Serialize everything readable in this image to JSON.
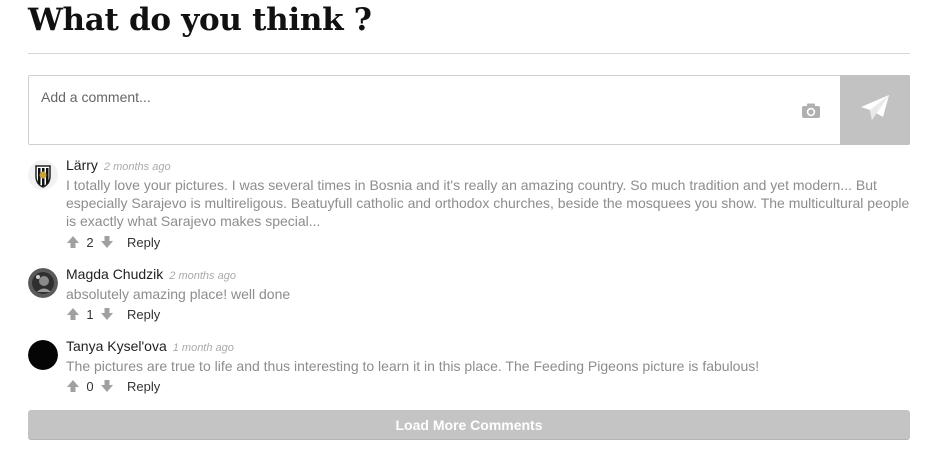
{
  "section": {
    "title": "What do you think ?"
  },
  "composer": {
    "placeholder": "Add a comment...",
    "camera_icon": "camera-icon",
    "send_icon": "paper-plane-icon",
    "send_color": "#c2c2c2"
  },
  "comments": [
    {
      "author": "Lärry",
      "time": "2 months ago",
      "text": "I totally love your pictures. I was several times in Bosnia and it's really an amazing country. So much tradition and yet modern... But especially Sarajevo is multireligous. Beatuyfull catholic and orthodox churches, beside the mosquees you show. The multicultural people is exactly what Sarajevo makes special...",
      "votes": "2",
      "reply": "Reply"
    },
    {
      "author": "Magda Chudzik",
      "time": "2 months ago",
      "text": "absolutely amazing place! well done",
      "votes": "1",
      "reply": "Reply"
    },
    {
      "author": "Tanya Kysel'ova",
      "time": "1 month ago",
      "text": "The pictures are true to life and thus interesting to learn it in this place. The Feeding Pigeons picture is fabulous!",
      "votes": "0",
      "reply": "Reply"
    }
  ],
  "load_more": {
    "label": "Load More Comments",
    "color": "#c4c4c4"
  }
}
